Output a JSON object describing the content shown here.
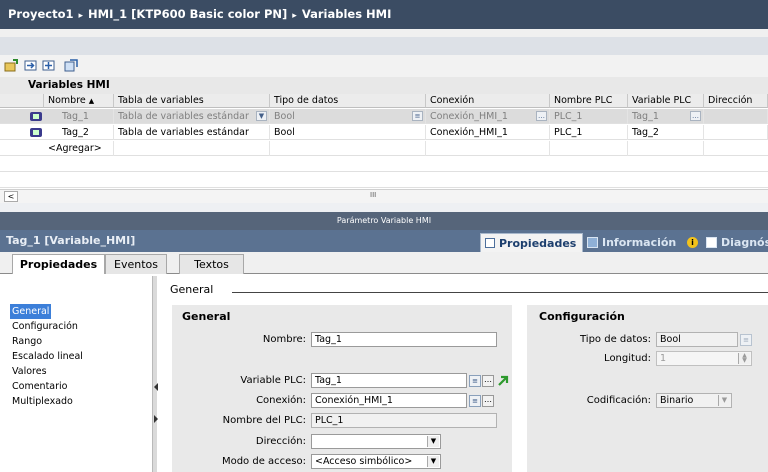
{
  "breadcrumb": [
    "Proyecto1",
    "HMI_1 [KTP600 Basic color PN]",
    "Variables HMI"
  ],
  "breadcrumb_sep": "▸",
  "grid": {
    "title": "Variables HMI",
    "columns": [
      "Nombre",
      "Tabla de variables",
      "Tipo de datos",
      "Conexión",
      "Nombre PLC",
      "Variable PLC",
      "Dirección"
    ],
    "sort_indicator": "▲",
    "rows": [
      {
        "name": "Tag_1",
        "table": "Tabla de variables estándar",
        "type": "Bool",
        "connection": "Conexión_HMI_1",
        "plc": "PLC_1",
        "plc_var": "Tag_1",
        "address": "",
        "selected": true
      },
      {
        "name": "Tag_2",
        "table": "Tabla de variables estándar",
        "type": "Bool",
        "connection": "Conexión_HMI_1",
        "plc": "PLC_1",
        "plc_var": "Tag_2",
        "address": "",
        "selected": false
      }
    ],
    "add_row": "<Agregar>"
  },
  "scroll": {
    "left_arrow": "<",
    "thumb": "III"
  },
  "param_bar": "Parámetro Variable HMI",
  "inspector": {
    "title": "Tag_1 [Variable_HMI]",
    "tabs": [
      "Propiedades",
      "Información",
      "Diagnóst"
    ],
    "subtabs": [
      "Propiedades",
      "Eventos",
      "Textos"
    ]
  },
  "nav": [
    "General",
    "Configuración",
    "Rango",
    "Escalado lineal",
    "Valores",
    "Comentario",
    "Multiplexado"
  ],
  "section_title": "General",
  "general": {
    "title": "General",
    "name_label": "Nombre:",
    "name_value": "Tag_1",
    "plc_var_label": "Variable PLC:",
    "plc_var_value": "Tag_1",
    "connection_label": "Conexión:",
    "connection_value": "Conexión_HMI_1",
    "plc_name_label": "Nombre del PLC:",
    "plc_name_value": "PLC_1",
    "direction_label": "Dirección:",
    "direction_value": "",
    "access_label": "Modo de acceso:",
    "access_value": "<Acceso simbólico>"
  },
  "config": {
    "title": "Configuración",
    "type_label": "Tipo de datos:",
    "type_value": "Bool",
    "length_label": "Longitud:",
    "length_value": "1",
    "coding_label": "Codificación:",
    "coding_value": "Binario"
  }
}
